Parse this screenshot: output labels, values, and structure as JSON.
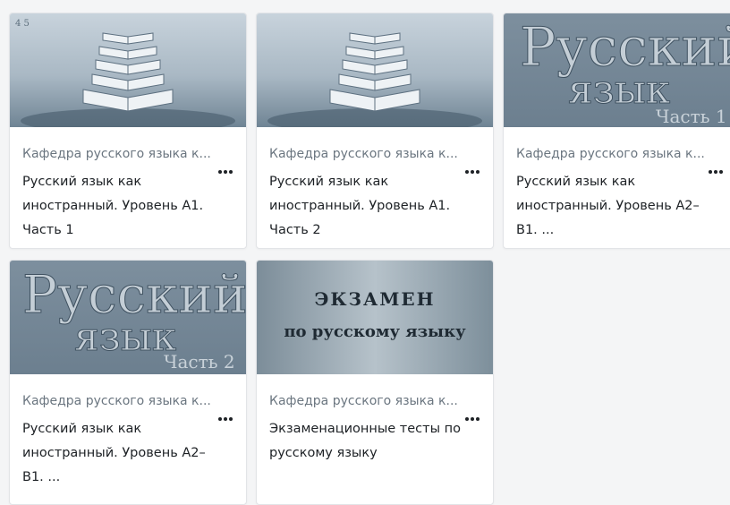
{
  "courses": [
    {
      "category": "Кафедра русского языка к...",
      "title_lines": [
        "Русский язык как",
        "иностранный. Уровень А1.",
        "Часть 1"
      ],
      "image": "stacked-books"
    },
    {
      "category": "Кафедра русского языка к...",
      "title_lines": [
        "Русский язык как",
        "иностранный. Уровень А1.",
        "Часть 2"
      ],
      "image": "stacked-books"
    },
    {
      "category": "Кафедра русского языка к...",
      "title_lines": [
        "Русский язык как",
        "иностранный. Уровень А2–",
        "В1. ..."
      ],
      "image": "russkiy-yazyk-cover",
      "image_text": [
        "Русский",
        "язык",
        "Часть 1"
      ]
    },
    {
      "category": "Кафедра русского языка к...",
      "title_lines": [
        "Русский язык как",
        "иностранный. Уровень А2–",
        "В1. ..."
      ],
      "image": "russkiy-yazyk-cover",
      "image_text": [
        "Русский",
        "язык",
        "Часть 2"
      ]
    },
    {
      "category": "Кафедра русского языка к...",
      "title_lines": [
        "Экзаменационные тесты по",
        "русскому языку"
      ],
      "image": "exam-cover",
      "image_text": [
        "ЭКЗАМЕН",
        "по русскому языку"
      ]
    }
  ],
  "icons": {
    "more_menu": "more-horizontal-icon"
  },
  "colors": {
    "card_bg": "#ffffff",
    "category_text": "#6b7680",
    "title_text": "#1d2125"
  }
}
